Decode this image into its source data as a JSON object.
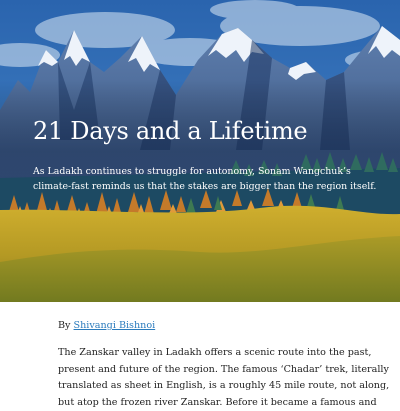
{
  "hero": {
    "title": "21 Days and a Lifetime",
    "subtitle": "As Ladakh continues to struggle for autonomy, Sonam Wangchuk’s climate-fast reminds us that the stakes are bigger than the region itself."
  },
  "byline": {
    "prefix": "By",
    "author": "Shivangi Bishnoi"
  },
  "article": {
    "lines": [
      "The Zanskar valley in Ladakh offers a scenic route into the past,",
      "present and future of the region. The famous ‘Chadar’ trek, literally",
      "translated as sheet in English, is a roughly 45 mile route, not along,",
      "but atop the frozen river Zanskar. Before it became a famous and"
    ]
  },
  "colors": {
    "sky": "#2e6fb4",
    "mountain": "#2d4a7a",
    "forest": "#1d4a63",
    "meadow": "#c8a42a",
    "link": "#2a7bbd"
  }
}
